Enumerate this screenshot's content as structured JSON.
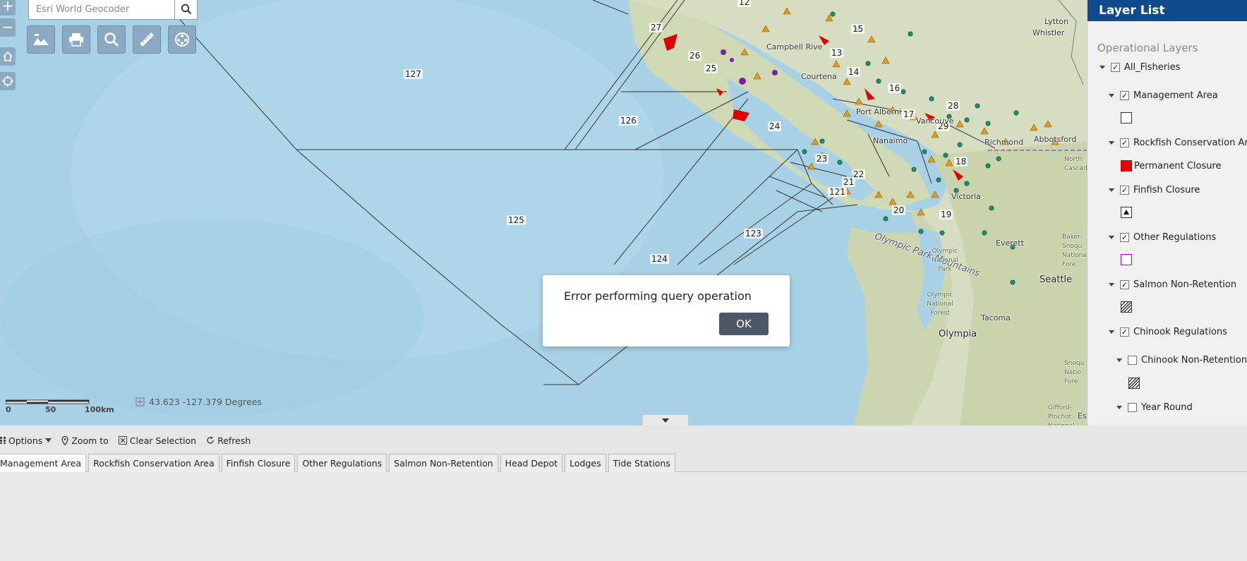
{
  "search": {
    "placeholder": "Esri World Geocoder"
  },
  "zoom": {
    "in_label": "+",
    "out_label": "−"
  },
  "toolbar": {
    "buttons": [
      {
        "name": "basemap-icon"
      },
      {
        "name": "print-icon"
      },
      {
        "name": "search-icon"
      },
      {
        "name": "measure-icon"
      },
      {
        "name": "film-icon"
      }
    ]
  },
  "map": {
    "zone_labels": [
      "127",
      "126",
      "125",
      "124",
      "123",
      "121",
      "22",
      "21",
      "20",
      "19",
      "18",
      "29",
      "17",
      "28",
      "16",
      "14",
      "13",
      "15",
      "12",
      "27",
      "26",
      "25",
      "24",
      "23"
    ],
    "places": {
      "whistler": "Whistler",
      "lytton": "Lytton",
      "campbell_river": "Campbell Rive",
      "courtenay": "Courtena",
      "port_alberni": "Port Alberni",
      "nanaimo": "Nanaimo",
      "vancouver": "Vancouve",
      "richmond": "Richmond",
      "abbotsford": "Abbotsford",
      "victoria": "Victoria",
      "everett": "Everett",
      "seattle": "Seattle",
      "tacoma": "Tacoma",
      "olympia": "Olympia",
      "olympic_mountains": "Olympic Park Mountains",
      "olympic_np": "Olympic National Park",
      "olympic_nf": "Olympic National Forest",
      "north_cascades": "North Cascade",
      "mt_baker": "Baker-Snoqu National Fore",
      "gifford": "Gifford-Pinchot National Forest",
      "snoqualmie": "Snoqu Natio Fore",
      "es": "Es"
    }
  },
  "scale": {
    "labels": [
      "0",
      "50",
      "100km"
    ]
  },
  "coords": {
    "text": "43.623  -127.379 Degrees"
  },
  "dialog": {
    "message": "Error performing query operation",
    "ok_label": "OK"
  },
  "layer_list": {
    "title": "Layer List",
    "section_title": "Operational Layers",
    "items": [
      {
        "label": "All_Fisheries",
        "checked": true
      },
      {
        "label": "Management Area",
        "checked": true
      },
      {
        "label": "Rockfish Conservation Area",
        "checked": true
      },
      {
        "label": "Permanent Closure"
      },
      {
        "label": "Finfish Closure",
        "checked": true
      },
      {
        "label": "Other Regulations",
        "checked": true
      },
      {
        "label": "Salmon Non-Retention",
        "checked": true
      },
      {
        "label": "Chinook Regulations",
        "checked": true
      },
      {
        "label": "Chinook Non-Retention",
        "checked": false
      },
      {
        "label": "Year Round",
        "checked": false
      }
    ]
  },
  "attribute_toolbar": {
    "options_label": "Options",
    "zoom_label": "Zoom to",
    "clear_label": "Clear Selection",
    "refresh_label": "Refresh"
  },
  "tabs": [
    {
      "label": "Management Area",
      "active": true
    },
    {
      "label": "Rockfish Conservation Area"
    },
    {
      "label": "Finfish Closure"
    },
    {
      "label": "Other Regulations"
    },
    {
      "label": "Salmon Non-Retention"
    },
    {
      "label": "Head Depot"
    },
    {
      "label": "Lodges"
    },
    {
      "label": "Tide Stations"
    }
  ],
  "colors": {
    "ocean": "#a9d1e6",
    "land": "#d6ddc0",
    "header_blue": "#0d4b8a",
    "closure_red": "#e00000",
    "marker_orange": "#e39b1a",
    "marker_green": "#1e8f6e"
  }
}
